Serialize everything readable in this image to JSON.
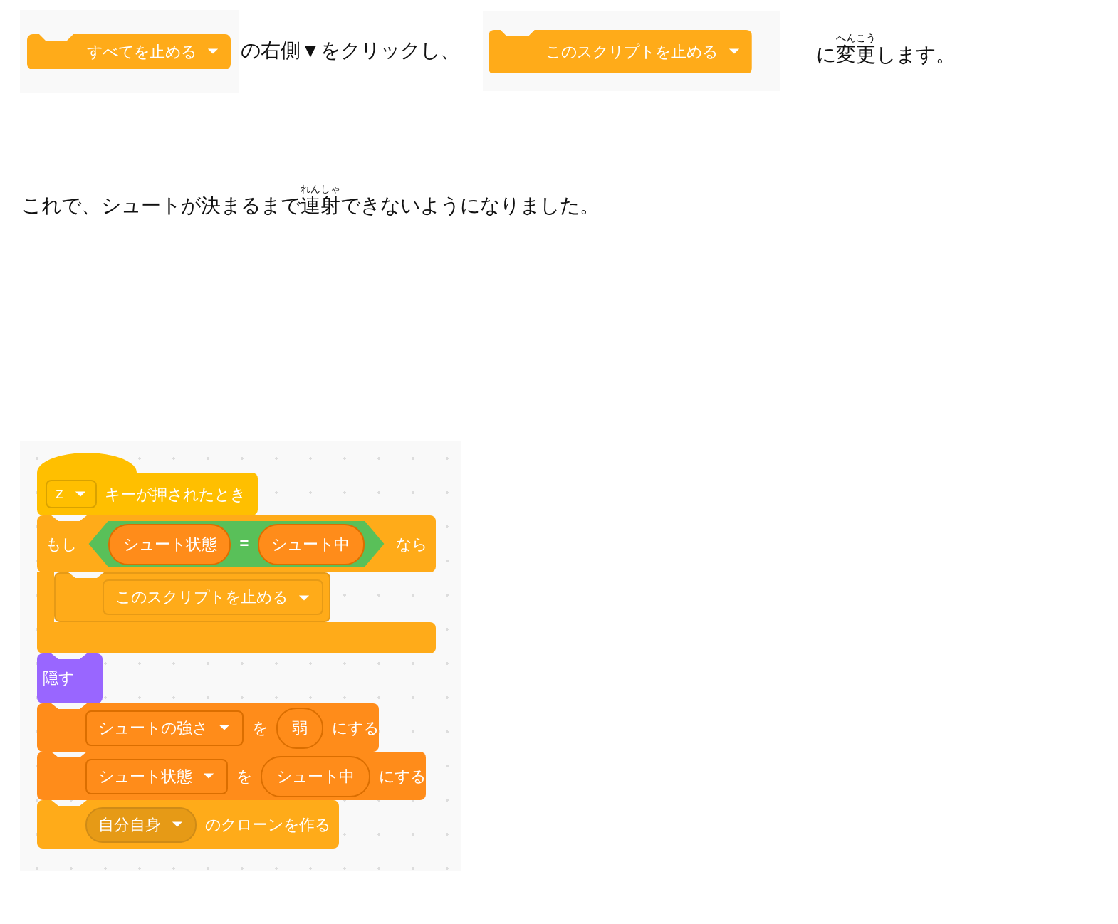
{
  "instruction": {
    "block_from": {
      "dropdown": "すべてを止める"
    },
    "text_middle": "の右側▼をクリックし、",
    "block_to": {
      "dropdown": "このスクリプトを止める"
    },
    "text_end": [
      {
        "text": "に"
      },
      {
        "text": "変更",
        "ruby": "へんこう"
      },
      {
        "text": "します。"
      }
    ]
  },
  "result": {
    "segments": [
      {
        "text": "これで、シュートが決まるまで"
      },
      {
        "text": "連射",
        "ruby": "れんしゃ"
      },
      {
        "text": "できないようになりました。"
      }
    ]
  },
  "script": {
    "blocks": [
      {
        "kind": "hat",
        "dropdown": "z",
        "label": "キーが押されたとき"
      },
      {
        "kind": "if",
        "prefix": "もし",
        "condition": {
          "left": "シュート状態",
          "op": "=",
          "right": "シュート中"
        },
        "suffix": "なら",
        "children": [
          {
            "kind": "stop",
            "dropdown": "このスクリプトを止める"
          }
        ]
      },
      {
        "kind": "looks",
        "label": "隠す"
      },
      {
        "kind": "set",
        "variable": "シュートの強さ",
        "word": "を",
        "value": "弱",
        "tail": "にする"
      },
      {
        "kind": "set",
        "variable": "シュート状態",
        "word": "を",
        "value": "シュート中",
        "tail": "にする"
      },
      {
        "kind": "clone",
        "dropdown": "自分自身",
        "tail": "のクローンを作る"
      }
    ]
  }
}
